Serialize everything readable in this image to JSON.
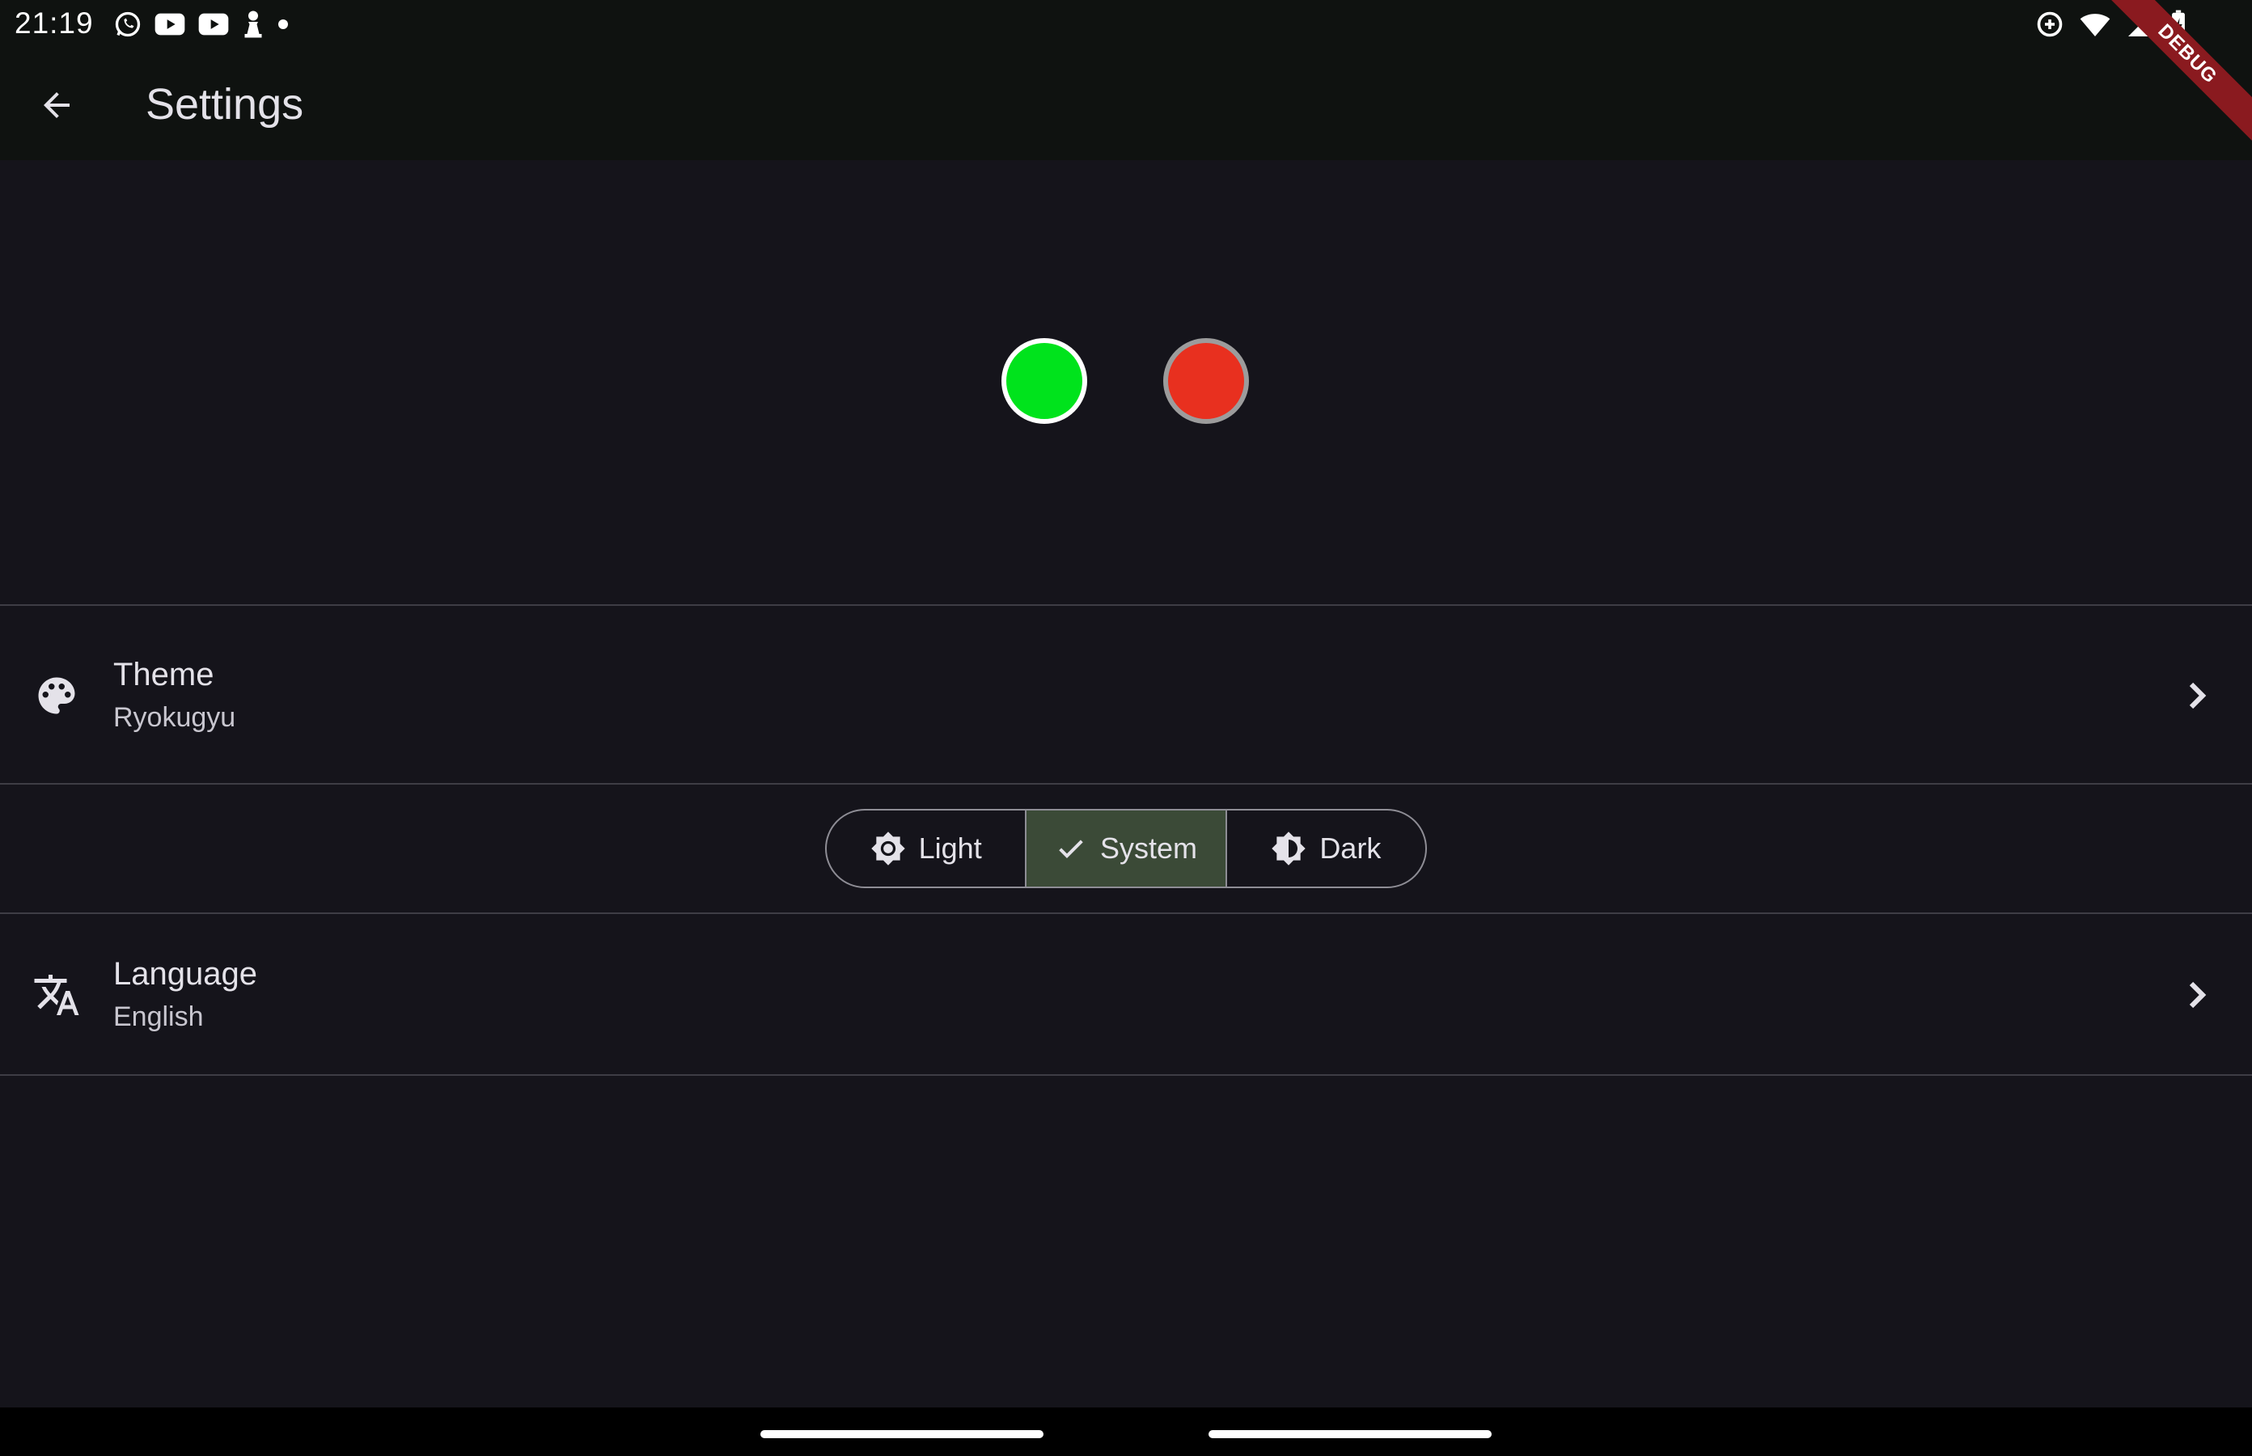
{
  "status_bar": {
    "time": "21:19",
    "left_icons": [
      "whatsapp-icon",
      "youtube-icon",
      "youtube-icon",
      "chess-pawn-icon",
      "dot-icon"
    ],
    "right_icons": [
      "data-saver-icon",
      "wifi-icon",
      "signal-icon",
      "battery-charging-icon"
    ]
  },
  "app_bar": {
    "title": "Settings",
    "back_icon": "arrow-back-icon"
  },
  "debug_banner": "DEBUG",
  "color_swatches": [
    {
      "name": "green",
      "color": "#00e31c",
      "selected": true
    },
    {
      "name": "red",
      "color": "#e8301f",
      "selected": false
    }
  ],
  "theme_tile": {
    "title": "Theme",
    "subtitle": "Ryokugyu",
    "icon": "palette-icon"
  },
  "brightness": {
    "options": [
      {
        "label": "Light",
        "icon": "brightness-high-icon",
        "selected": false
      },
      {
        "label": "System",
        "icon": "check-icon",
        "selected": true
      },
      {
        "label": "Dark",
        "icon": "brightness-low-icon",
        "selected": false
      }
    ]
  },
  "language_tile": {
    "title": "Language",
    "subtitle": "English",
    "icon": "translate-icon"
  },
  "colors": {
    "background": "#15141b",
    "app_bar": "#0f1210",
    "selected_segment": "#3b4a37",
    "divider": "#3e3d45"
  }
}
